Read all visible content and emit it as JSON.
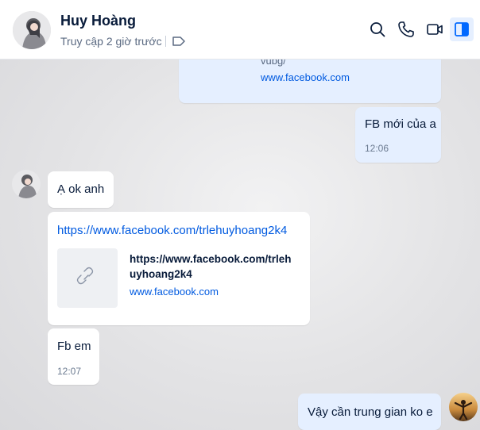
{
  "header": {
    "name": "Huy Hoàng",
    "status": "Truy cập 2 giờ trước"
  },
  "messages": {
    "top_preview_tail": "vubg/",
    "top_preview_domain": "www.facebook.com",
    "me_1_text": "FB mới của a",
    "me_1_time": "12:06",
    "them_1_text": "Ạ ok anh",
    "them_link_url": "https://www.facebook.com/trlehuyhoang2k4",
    "them_link_title_1": "https://www.facebook.com/trleh",
    "them_link_title_2": "uyhoang2k4",
    "them_link_domain": "www.facebook.com",
    "them_2_text": "Fb em",
    "them_2_time": "12:07",
    "me_2_text": "Vậy cần trung gian ko e"
  },
  "colors": {
    "my_bubble": "#e5efff",
    "their_bubble": "#ffffff",
    "link": "#005ae0",
    "accent": "#0068ff"
  }
}
